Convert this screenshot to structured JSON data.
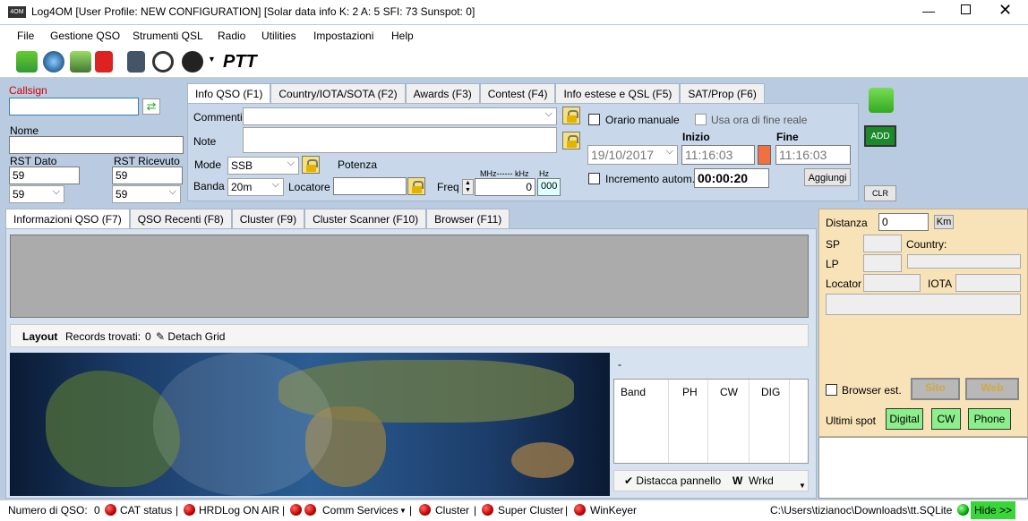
{
  "window": {
    "title": "Log4OM [User Profile: NEW CONFIGURATION] [Solar data info K: 2 A: 5 SFI: 73 Sunspot: 0]"
  },
  "menu": [
    "File",
    "Gestione QSO",
    "Strumenti QSL",
    "Radio",
    "Utilities",
    "Impostazioni",
    "Help"
  ],
  "toolbar": {
    "ptt": "PTT"
  },
  "qso": {
    "callsign_label": "Callsign",
    "nome_label": "Nome",
    "rst_sent_label": "RST Dato",
    "rst_rcvd_label": "RST Ricevuto",
    "rst_sent": "59",
    "rst_rcvd": "59",
    "rst_sent_sel": "59",
    "rst_rcvd_sel": "59"
  },
  "top_tabs": [
    "Info QSO (F1)",
    "Country/IOTA/SOTA (F2)",
    "Awards (F3)",
    "Contest (F4)",
    "Info estese e QSL (F5)",
    "SAT/Prop (F6)"
  ],
  "info": {
    "commenti": "Commenti",
    "note": "Note",
    "mode_label": "Mode",
    "mode": "SSB",
    "potenza": "Potenza",
    "banda_label": "Banda",
    "banda": "20m",
    "locatore": "Locatore",
    "freq_label": "Freq",
    "freq_units": "MHz------ kHz",
    "hz": "Hz",
    "freq_val": "0",
    "hz_val": "000",
    "orario_manuale": "Orario manuale",
    "usa_ora": "Usa ora di fine reale",
    "inizio": "Inizio",
    "fine": "Fine",
    "date": "19/10/2017",
    "start_time": "11:16:03",
    "end_time": "11:16:03",
    "incremento": "Incremento autom.",
    "duration": "00:00:20",
    "aggiungi": "Aggiungi"
  },
  "actions": {
    "add": "ADD",
    "clr": "CLR"
  },
  "bottom_tabs": [
    "Informazioni QSO (F7)",
    "QSO Recenti (F8)",
    "Cluster (F9)",
    "Cluster Scanner (F10)",
    "Browser (F11)"
  ],
  "grid_bar": {
    "layout": "Layout",
    "records": "Records trovati:",
    "count": "0",
    "detach": "Detach Grid"
  },
  "band_table": {
    "dash": "-",
    "headers": [
      "Band",
      "PH",
      "CW",
      "DIG"
    ],
    "detach": "Distacca pannello",
    "w": "W",
    "wrkd": "Wrkd"
  },
  "side": {
    "distanza": "Distanza",
    "distanza_val": "0",
    "km": "Km",
    "sp": "SP",
    "country": "Country:",
    "lp": "LP",
    "locator": "Locator",
    "iota": "IOTA",
    "browser_est": "Browser est.",
    "sito": "Sito",
    "web": "Web",
    "ultimi": "Ultimi spot",
    "digital": "Digital",
    "cw": "CW",
    "phone": "Phone"
  },
  "status": {
    "numero": "Numero di QSO:",
    "numero_val": "0",
    "cat": "CAT status",
    "hrd": "HRDLog ON AIR",
    "comm": "Comm Services",
    "cluster": "Cluster",
    "super": "Super Cluster",
    "winkeyer": "WinKeyer",
    "path": "C:\\Users\\tizianoc\\Downloads\\tt.SQLite",
    "hide": "Hide >>"
  }
}
